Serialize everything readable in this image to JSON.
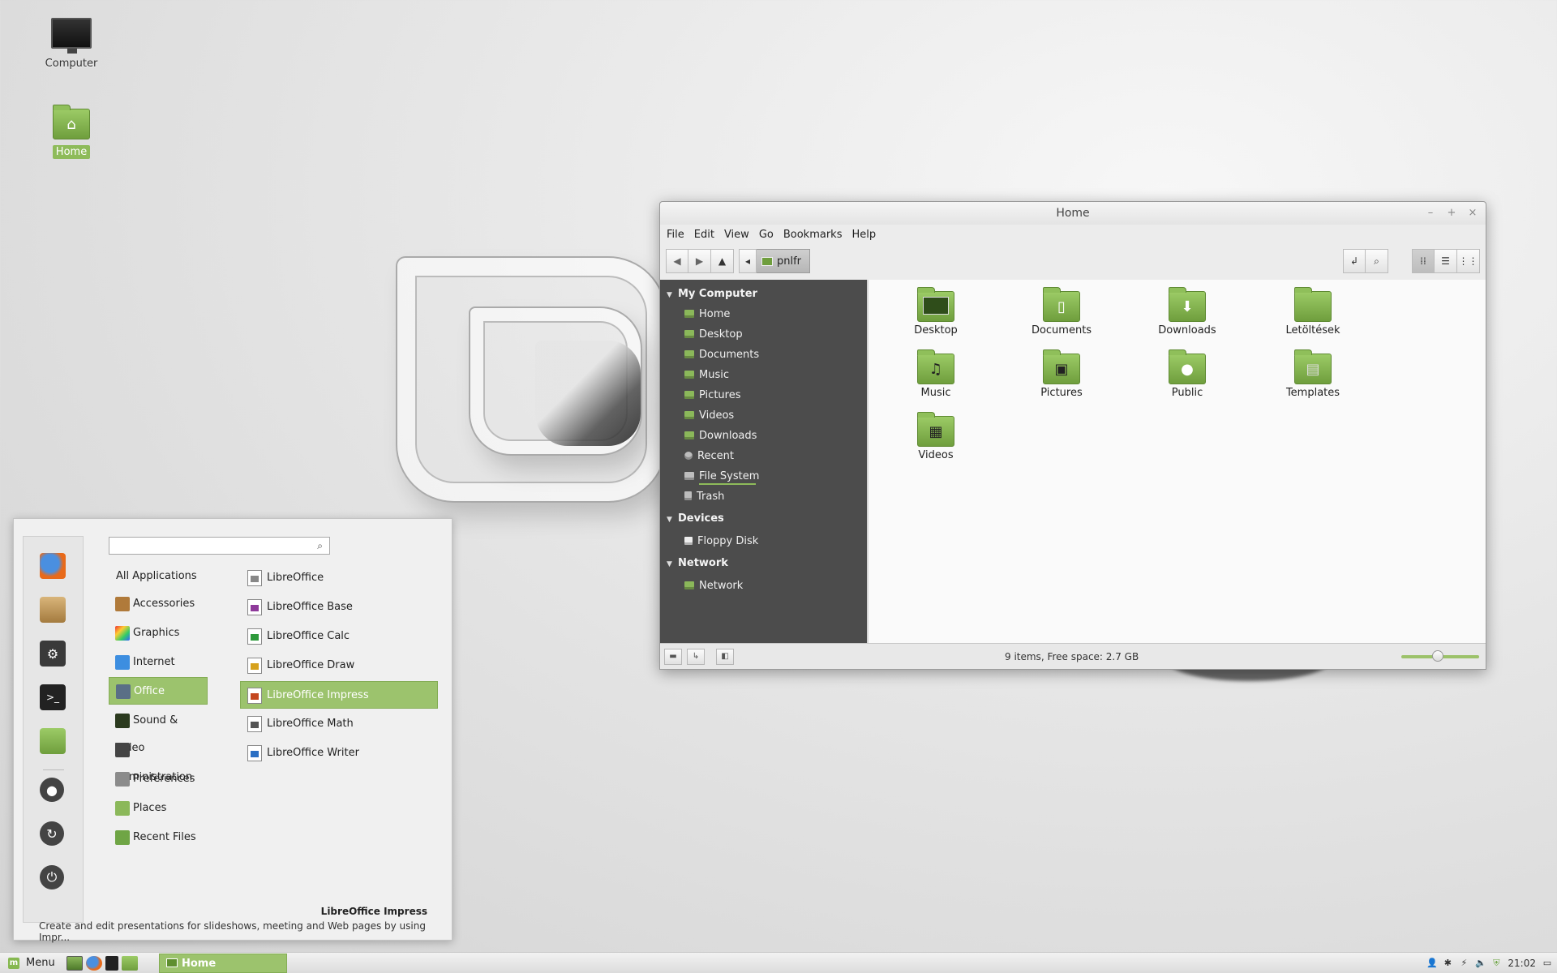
{
  "desktop": {
    "icons": [
      {
        "label": "Computer"
      },
      {
        "label": "Home"
      }
    ]
  },
  "window": {
    "title": "Home",
    "controls": {
      "minimize": "–",
      "maximize": "+",
      "close": "×"
    },
    "menu": [
      "File",
      "Edit",
      "View",
      "Go",
      "Bookmarks",
      "Help"
    ],
    "path_label": "pnlfr",
    "sidebar": {
      "sections": [
        {
          "heading": "My Computer",
          "items": [
            "Home",
            "Desktop",
            "Documents",
            "Music",
            "Pictures",
            "Videos",
            "Downloads",
            "Recent",
            "File System",
            "Trash"
          ]
        },
        {
          "heading": "Devices",
          "items": [
            "Floppy Disk"
          ]
        },
        {
          "heading": "Network",
          "items": [
            "Network"
          ]
        }
      ]
    },
    "files": [
      "Desktop",
      "Documents",
      "Downloads",
      "Letöltések",
      "Music",
      "Pictures",
      "Public",
      "Templates",
      "Videos"
    ],
    "status_text": "9 items, Free space: 2.7 GB",
    "zoom_level": 0.4
  },
  "start_menu": {
    "search_placeholder": "",
    "categories": [
      "All Applications",
      "Accessories",
      "Graphics",
      "Internet",
      "Office",
      "Sound & Video",
      "Administration",
      "Preferences",
      "Places",
      "Recent Files"
    ],
    "selected_category": "Office",
    "apps": [
      "LibreOffice",
      "LibreOffice Base",
      "LibreOffice Calc",
      "LibreOffice Draw",
      "LibreOffice Impress",
      "LibreOffice Math",
      "LibreOffice Writer"
    ],
    "selected_app": "LibreOffice Impress",
    "description_title": "LibreOffice Impress",
    "description_text": "Create and edit presentations for slideshows, meeting and Web pages by using Impr..."
  },
  "panel": {
    "menu_label": "Menu",
    "task_label": "Home",
    "clock": "21:02"
  },
  "colors": {
    "accent": "#9cc36d",
    "sidebar_bg": "#4c4c4c"
  }
}
